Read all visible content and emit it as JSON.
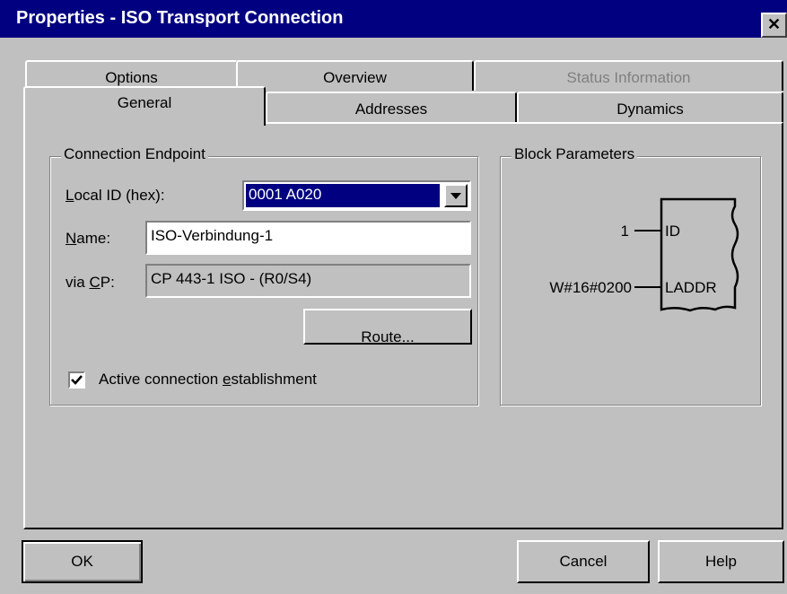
{
  "window": {
    "title": "Properties - ISO Transport Connection",
    "close_glyph": "✕"
  },
  "tabs_back": [
    {
      "label": "Options"
    },
    {
      "label": "Overview"
    },
    {
      "label": "Status Information",
      "disabled": true
    }
  ],
  "tabs_front": [
    {
      "label": "General",
      "active": true
    },
    {
      "label": "Addresses"
    },
    {
      "label": "Dynamics"
    }
  ],
  "endpoint": {
    "group_label": "Connection Endpoint",
    "local_id_label_u": "L",
    "local_id_label_rest": "ocal ID (hex):",
    "local_id_value": "0001 A020",
    "name_label_u": "N",
    "name_label_rest": "ame:",
    "name_value": "ISO-Verbindung-1",
    "via_cp_label_pre": "via ",
    "via_cp_label_u": "C",
    "via_cp_label_post": "P:",
    "via_cp_value": "CP 443-1 ISO - (R0/S4)",
    "route_button_u": "R",
    "route_button_rest": "oute...",
    "active_checkbox_pre": "Active connection ",
    "active_checkbox_u": "e",
    "active_checkbox_post": "stablishment",
    "active_checked": true
  },
  "block_params": {
    "group_label": "Block Parameters",
    "id_value": "1",
    "id_pin": "ID",
    "laddr_value": "W#16#0200",
    "laddr_pin": "LADDR"
  },
  "buttons": {
    "ok": "OK",
    "cancel": "Cancel",
    "help": "Help"
  },
  "icons": {
    "close": "close-icon",
    "dropdown": "chevron-down-icon",
    "check": "checkmark-icon"
  }
}
